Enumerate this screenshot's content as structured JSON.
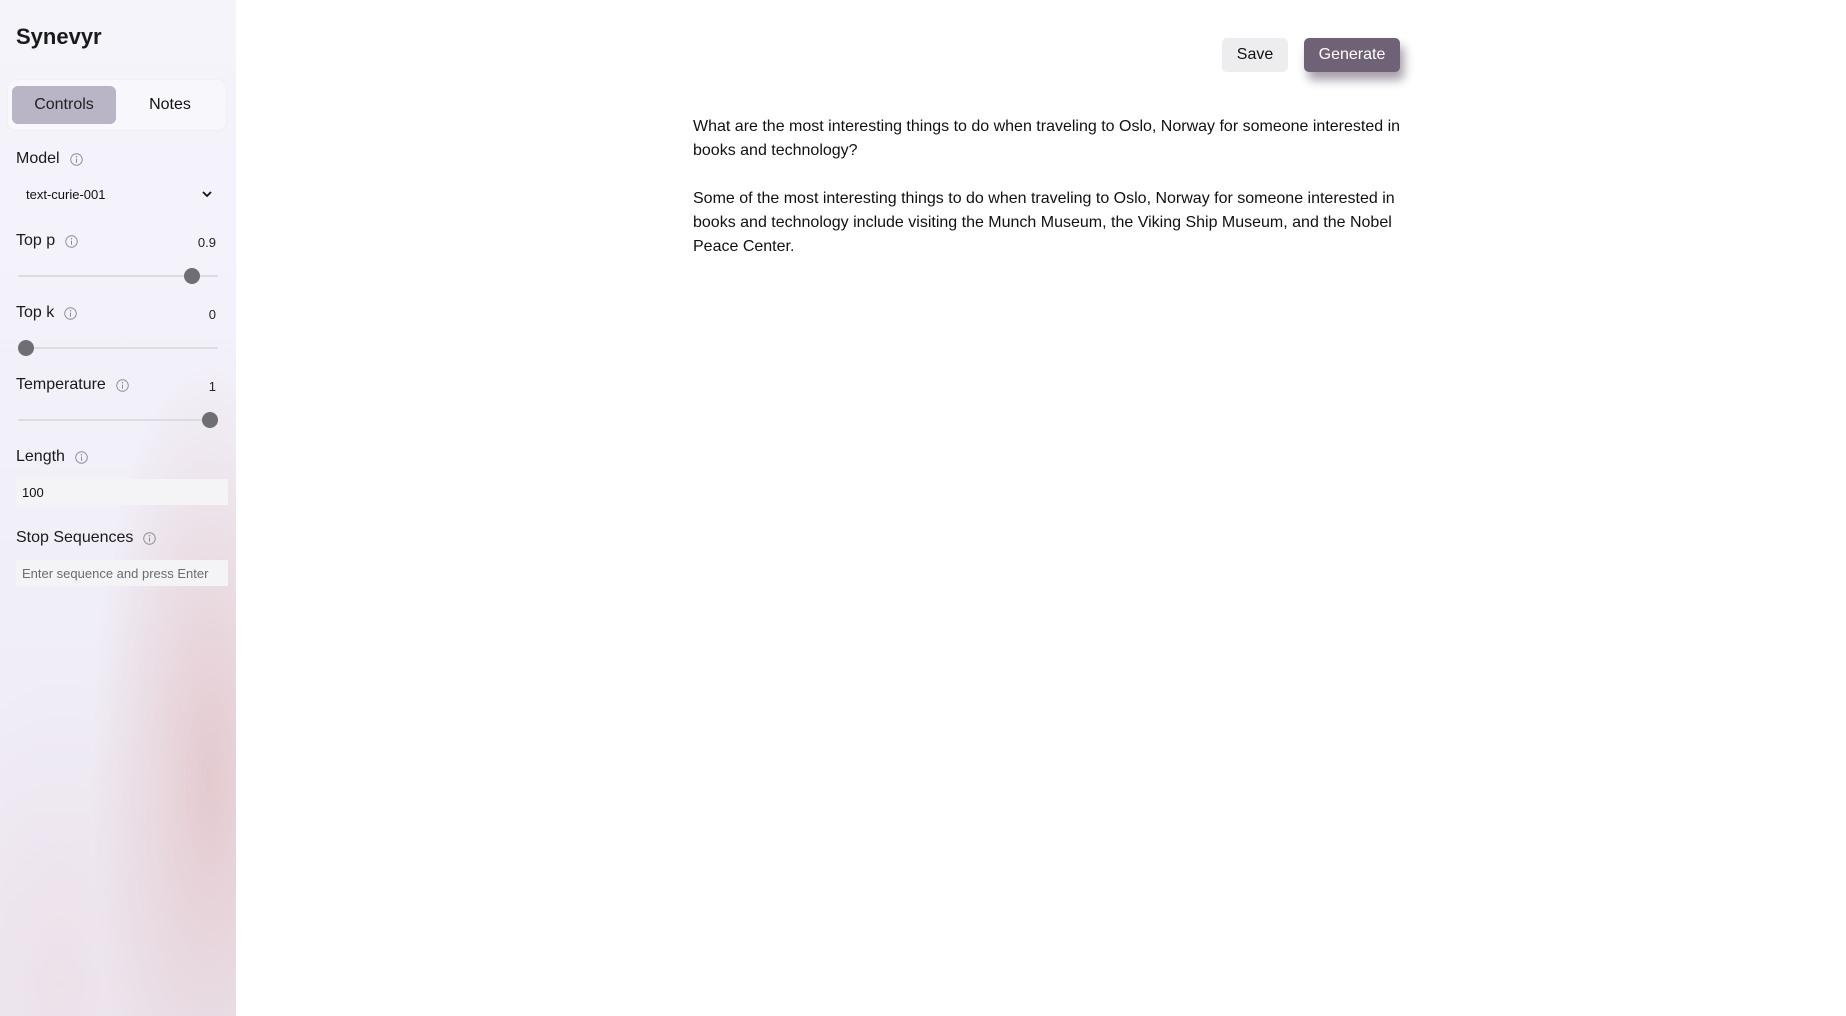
{
  "app": {
    "title": "Synevyr"
  },
  "tabs": [
    {
      "label": "Controls",
      "active": true
    },
    {
      "label": "Notes",
      "active": false
    }
  ],
  "controls": {
    "model": {
      "label": "Model",
      "value": "text-curie-001"
    },
    "top_p": {
      "label": "Top p",
      "value": "0.9",
      "level": 0.9
    },
    "top_k": {
      "label": "Top k",
      "value": "0",
      "level": 0.0
    },
    "temperature": {
      "label": "Temperature",
      "value": "1",
      "level": 1.0
    },
    "length": {
      "label": "Length",
      "value": "100"
    },
    "stop_sequences": {
      "label": "Stop Sequences",
      "placeholder": "Enter sequence and press Enter"
    }
  },
  "toolbar": {
    "save_label": "Save",
    "generate_label": "Generate"
  },
  "editor": {
    "prompt": "What are the most interesting things to do when traveling to Oslo, Norway for someone interested in books and technology?",
    "completion": "Some of the most interesting things to do when traveling to Oslo, Norway for someone interested in books and technology include visiting the Munch Museum, the Viking Ship Museum, and the Nobel Peace Center."
  },
  "colors": {
    "accent": "#6f6276",
    "active_tab": "#b9b4c6",
    "slider_thumb": "#6f6f73"
  },
  "icons": {
    "info": "info-circle-icon",
    "dropdown": "chevron-down-icon"
  }
}
